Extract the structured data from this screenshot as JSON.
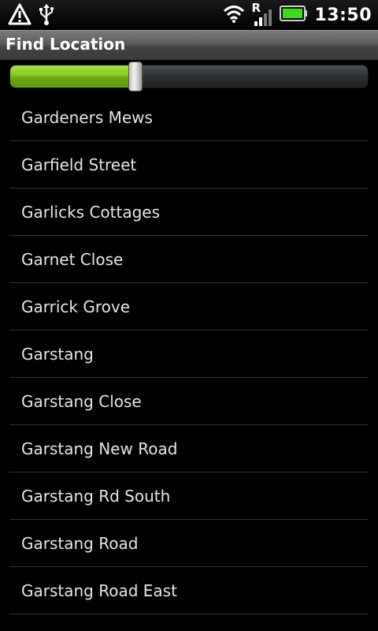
{
  "status_bar": {
    "icons": [
      "warning-icon",
      "usb-icon",
      "wifi-icon",
      "roaming-signal-icon",
      "battery-icon"
    ],
    "roaming_label": "R",
    "time": "13:50",
    "battery_color": "#3fd91f"
  },
  "title_bar": {
    "title": "Find Location"
  },
  "slider": {
    "value_percent": 35,
    "fill_color": "#86c521"
  },
  "list": {
    "items": [
      {
        "label": "Gardeners Mews"
      },
      {
        "label": "Garfield Street"
      },
      {
        "label": "Garlicks Cottages"
      },
      {
        "label": "Garnet Close"
      },
      {
        "label": "Garrick Grove"
      },
      {
        "label": "Garstang"
      },
      {
        "label": "Garstang Close"
      },
      {
        "label": "Garstang New Road"
      },
      {
        "label": "Garstang Rd South"
      },
      {
        "label": "Garstang Road"
      },
      {
        "label": "Garstang Road East"
      }
    ]
  }
}
